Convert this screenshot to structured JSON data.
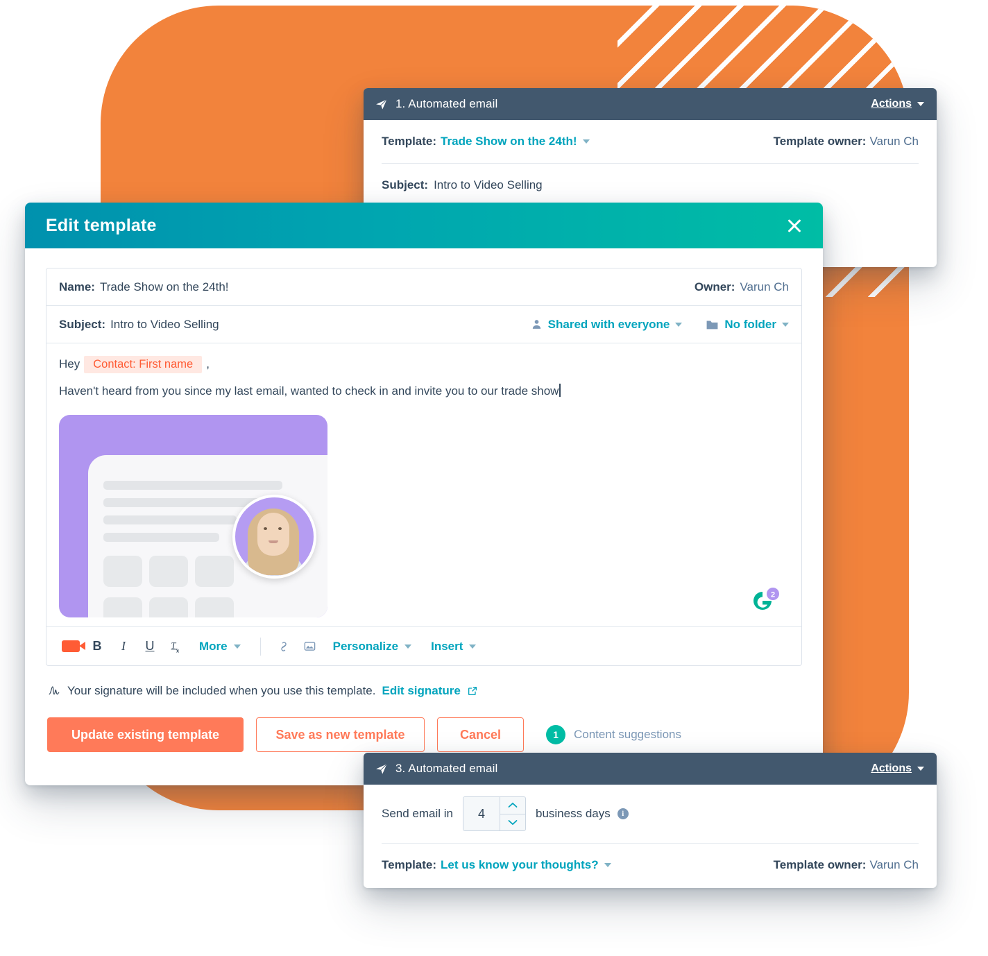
{
  "panel_top": {
    "icon": "paper-plane-icon",
    "title": "1. Automated email",
    "actions_label": "Actions",
    "template_label": "Template:",
    "template_value": "Trade Show on the 24th!",
    "owner_label": "Template owner:",
    "owner_value": "Varun Ch",
    "subject_label": "Subject:",
    "subject_value": "Intro to Video Selling"
  },
  "panel_bottom": {
    "icon": "paper-plane-icon",
    "title": "3. Automated email",
    "actions_label": "Actions",
    "send_prefix": "Send email in",
    "delay_value": "4",
    "send_suffix": "business days",
    "info_glyph": "i",
    "template_label": "Template:",
    "template_value": "Let us know your thoughts?",
    "owner_label": "Template owner:",
    "owner_value": "Varun Ch"
  },
  "modal": {
    "title": "Edit template",
    "close_icon": "close-icon",
    "name_label": "Name:",
    "name_value": "Trade Show on the 24th!",
    "owner_label": "Owner:",
    "owner_value": "Varun Ch",
    "subject_label": "Subject:",
    "subject_value": "Intro to Video Selling",
    "sharing_label": "Shared with everyone",
    "folder_label": "No folder",
    "body": {
      "greeting": "Hey",
      "token": "Contact: First name",
      "comma": ",",
      "line2": "Haven't heard from you since my last email, wanted to check in and invite you to our trade show"
    },
    "g2_badge": {
      "letter": "G",
      "count": "2"
    },
    "toolbar": {
      "video_icon": "video-camera-icon",
      "bold": "B",
      "italic": "I",
      "underline": "U",
      "clear_format": "Tx",
      "more": "More",
      "link_icon": "link-icon",
      "image_icon": "image-icon",
      "personalize": "Personalize",
      "insert": "Insert"
    },
    "signature": {
      "icon": "signature-icon",
      "text": "Your signature will be included when you use this template.",
      "link": "Edit signature",
      "external_icon": "external-link-icon"
    },
    "buttons": {
      "update": "Update existing template",
      "save_new": "Save as new template",
      "cancel": "Cancel"
    },
    "suggestions": {
      "count": "1",
      "label": "Content suggestions"
    }
  },
  "colors": {
    "orange_bg": "#F2833C",
    "panel_header": "#42586E",
    "modal_gradient_start": "#0091AE",
    "modal_gradient_end": "#00BDA5",
    "teal_link": "#00A4BD",
    "hubspot_orange": "#FF7A59",
    "token_orange": "#FF5C35",
    "text_dark": "#33475B"
  }
}
